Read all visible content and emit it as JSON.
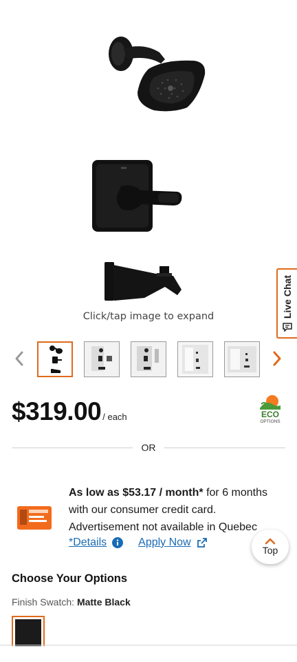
{
  "hero": {
    "expand_hint": "Click/tap image to expand"
  },
  "live_chat": {
    "label": "Live Chat",
    "icon": "chat-icon"
  },
  "gallery": {
    "prev_icon": "chevron-left-icon",
    "next_icon": "chevron-right-icon",
    "selected_index": 0,
    "thumbnail_count": 5
  },
  "price": {
    "amount": "$319.00",
    "unit": "/ each",
    "eco_badge_top": "ECO",
    "eco_badge_bottom": "OPTIONS"
  },
  "divider": {
    "or_label": "OR"
  },
  "financing": {
    "headline_bold": "As low as $53.17 / month*",
    "headline_rest": " for 6 months with our consumer credit card. Advertisement not available in Quebec",
    "details_link": "*Details",
    "apply_link": "Apply Now"
  },
  "scroll_top": {
    "label": "Top"
  },
  "options": {
    "title": "Choose Your Options",
    "swatch_label": "Finish Swatch:",
    "swatch_value": "Matte Black",
    "swatch_color": "#1b1b1b"
  },
  "colors": {
    "accent": "#e06a1b",
    "link": "#196bb5"
  }
}
